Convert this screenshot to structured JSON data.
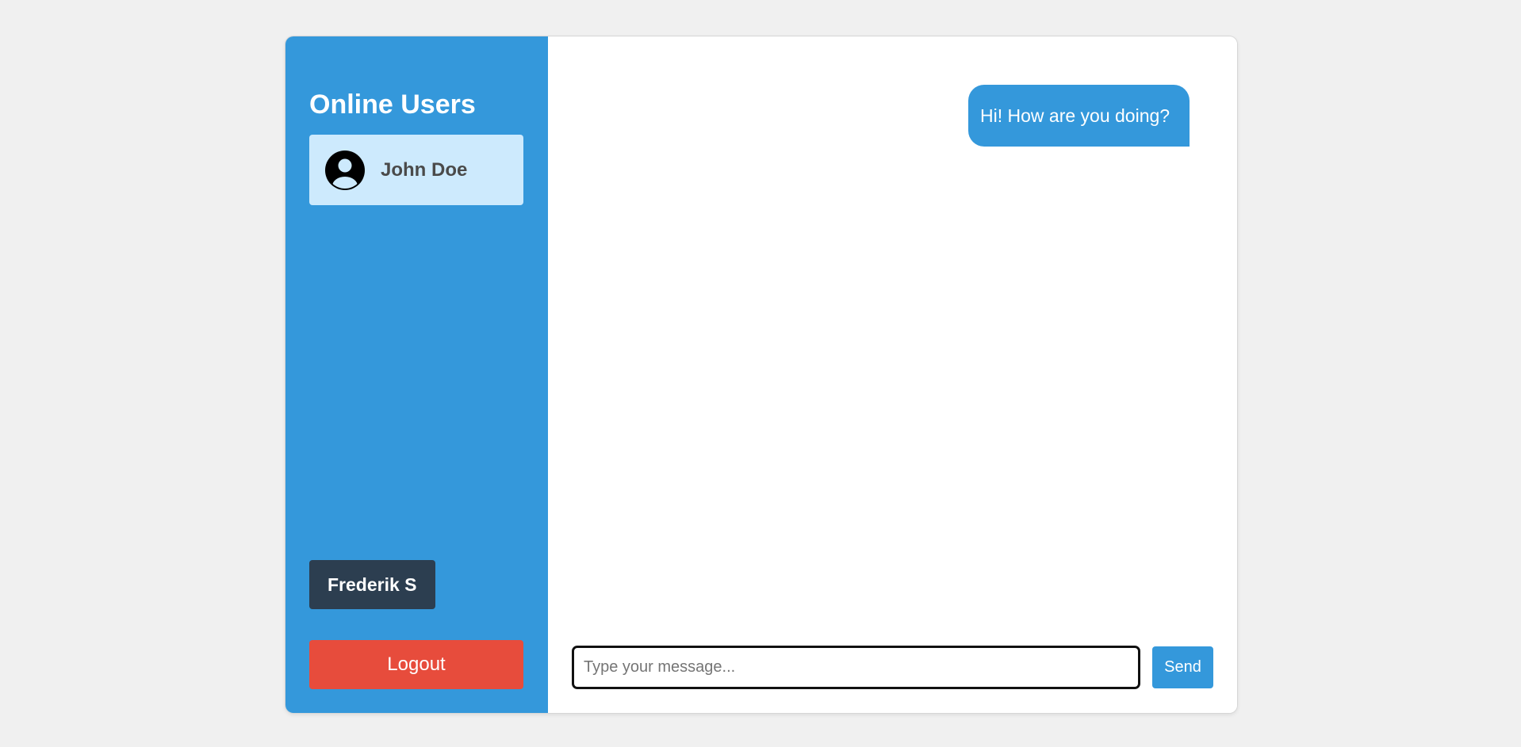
{
  "sidebar": {
    "title": "Online Users",
    "users": [
      {
        "name": "John Doe",
        "avatar_icon": "user-avatar-icon"
      }
    ],
    "current_user": "Frederik S",
    "logout_label": "Logout"
  },
  "chat": {
    "messages": [
      {
        "text": "Hi! How are you doing?",
        "sender": "self"
      }
    ]
  },
  "composer": {
    "placeholder": "Type your message...",
    "value": "",
    "send_label": "Send"
  },
  "colors": {
    "background": "#f0f0f0",
    "sidebar": "#3498db",
    "user_item": "#cdeafd",
    "current_user_badge": "#2c3e50",
    "logout": "#e74c3c",
    "message_bubble": "#3498db",
    "send_button": "#3498db"
  }
}
